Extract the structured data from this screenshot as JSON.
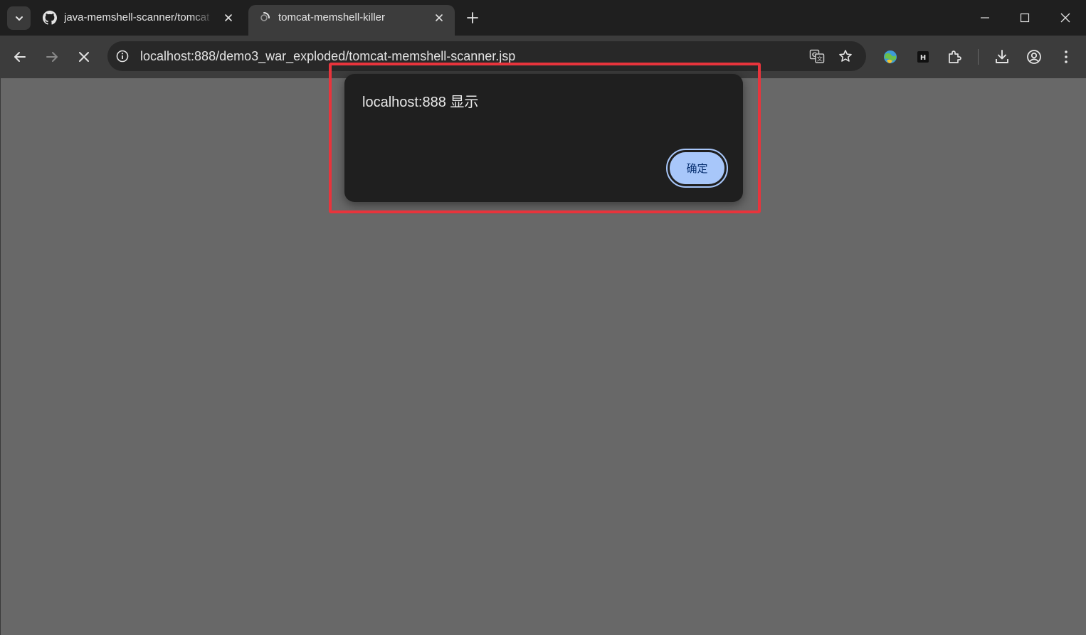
{
  "browser": {
    "tabs": [
      {
        "title": "java-memshell-scanner/tomcat",
        "active": false,
        "favicon": "github-icon"
      },
      {
        "title": "tomcat-memshell-killer",
        "active": true,
        "favicon": "loading-globe-icon"
      }
    ],
    "address_bar": {
      "url": "localhost:888/demo3_war_exploded/tomcat-memshell-scanner.jsp"
    },
    "window_controls": [
      "minimize-icon",
      "maximize-icon",
      "close-icon"
    ],
    "toolbar_icons": [
      "translate-icon",
      "star-icon",
      "extension-1-icon",
      "extension-2-icon",
      "puzzle-icon",
      "download-icon",
      "profile-icon",
      "menu-icon"
    ]
  },
  "dialog": {
    "message": "localhost:888 显示",
    "ok_label": "确定"
  },
  "colors": {
    "page_background": "#686868",
    "dialog_background": "#1f1f1f",
    "button_fill": "#a8c7fa",
    "highlight_border": "#e8343c"
  }
}
